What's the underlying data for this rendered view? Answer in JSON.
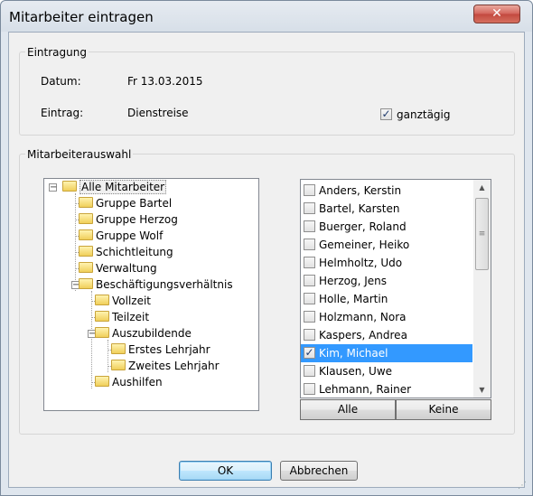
{
  "window": {
    "title": "Mitarbeiter eintragen",
    "close_label": "✕"
  },
  "eintragung": {
    "group_label": "Eintragung",
    "datum_label": "Datum:",
    "datum_value": "Fr 13.03.2015",
    "eintrag_label": "Eintrag:",
    "eintrag_value": "Dienstreise",
    "ganztaegig_label": "ganztägig",
    "ganztaegig_checked": true
  },
  "auswahl": {
    "group_label": "Mitarbeiterauswahl",
    "tree": [
      {
        "label": "Alle Mitarbeiter",
        "expanded": true,
        "selected": true
      },
      {
        "label": "Gruppe Bartel"
      },
      {
        "label": "Gruppe Herzog"
      },
      {
        "label": "Gruppe Wolf"
      },
      {
        "label": "Schichtleitung"
      },
      {
        "label": "Verwaltung"
      },
      {
        "label": "Beschäftigungsverhältnis",
        "expanded": true
      },
      {
        "label": "Vollzeit"
      },
      {
        "label": "Teilzeit"
      },
      {
        "label": "Auszubildende",
        "expanded": true
      },
      {
        "label": "Erstes Lehrjahr"
      },
      {
        "label": "Zweites Lehrjahr"
      },
      {
        "label": "Aushilfen"
      }
    ],
    "employees": [
      {
        "name": "Anders, Kerstin",
        "checked": false
      },
      {
        "name": "Bartel, Karsten",
        "checked": false
      },
      {
        "name": "Buerger, Roland",
        "checked": false
      },
      {
        "name": "Gemeiner, Heiko",
        "checked": false
      },
      {
        "name": "Helmholtz, Udo",
        "checked": false
      },
      {
        "name": "Herzog, Jens",
        "checked": false
      },
      {
        "name": "Holle, Martin",
        "checked": false
      },
      {
        "name": "Holzmann, Nora",
        "checked": false
      },
      {
        "name": "Kaspers, Andrea",
        "checked": false
      },
      {
        "name": "Kim, Michael",
        "checked": true,
        "selected": true
      },
      {
        "name": "Klausen, Uwe",
        "checked": false
      },
      {
        "name": "Lehmann, Rainer",
        "checked": false
      }
    ],
    "alle_button": "Alle",
    "keine_button": "Keine"
  },
  "footer": {
    "ok_label": "OK",
    "cancel_label": "Abbrechen"
  },
  "icons": {
    "tree_node": "folder-icon",
    "expander": "tree-expander-icon",
    "check": "checkmark-icon"
  },
  "colors": {
    "selection": "#3399ff",
    "titlebar": "#dfe6ee",
    "close": "#c2483e"
  }
}
